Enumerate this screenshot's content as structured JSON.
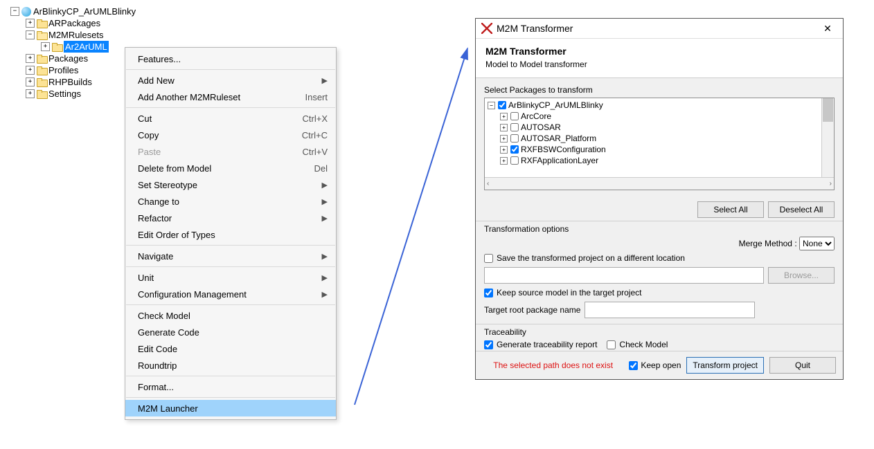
{
  "tree": {
    "root": "ArBlinkyCP_ArUMLBlinky",
    "items": [
      "ARPackages",
      "M2MRulesets",
      "Packages",
      "Profiles",
      "RHPBuilds",
      "Settings"
    ],
    "selected": "Ar2ArUML"
  },
  "ctx": {
    "features": "Features...",
    "add_new": "Add New",
    "add_another": "Add Another M2MRuleset",
    "add_another_sc": "Insert",
    "cut": "Cut",
    "cut_sc": "Ctrl+X",
    "copy": "Copy",
    "copy_sc": "Ctrl+C",
    "paste": "Paste",
    "paste_sc": "Ctrl+V",
    "delete": "Delete from Model",
    "delete_sc": "Del",
    "stereo": "Set Stereotype",
    "change": "Change to",
    "refactor": "Refactor",
    "edit_order": "Edit Order of Types",
    "navigate": "Navigate",
    "unit": "Unit",
    "config": "Configuration Management",
    "check": "Check Model",
    "gen": "Generate Code",
    "editc": "Edit Code",
    "round": "Roundtrip",
    "format": "Format...",
    "m2m": "M2M Launcher"
  },
  "dlg": {
    "title": "M2M Transformer",
    "heading": "M2M Transformer",
    "sub": "Model to Model transformer",
    "select_label": "Select Packages to transform",
    "pkgs": {
      "root": "ArBlinkyCP_ArUMLBlinky",
      "children": [
        "ArcCore",
        "AUTOSAR",
        "AUTOSAR_Platform",
        "RXFBSWConfiguration",
        "RXFApplicationLayer"
      ]
    },
    "select_all": "Select All",
    "deselect_all": "Deselect All",
    "trans_opts": "Transformation options",
    "merge_label": "Merge Method :",
    "merge_value": "None",
    "save_diff": "Save the transformed project on a different location",
    "browse": "Browse...",
    "keep_src": "Keep source model in the target project",
    "target_label": "Target root package name",
    "trace": "Traceability",
    "gen_trace": "Generate traceability report",
    "check_model": "Check Model",
    "err": "The selected path does not exist",
    "keep_open": "Keep open",
    "transform": "Transform project",
    "quit": "Quit"
  }
}
